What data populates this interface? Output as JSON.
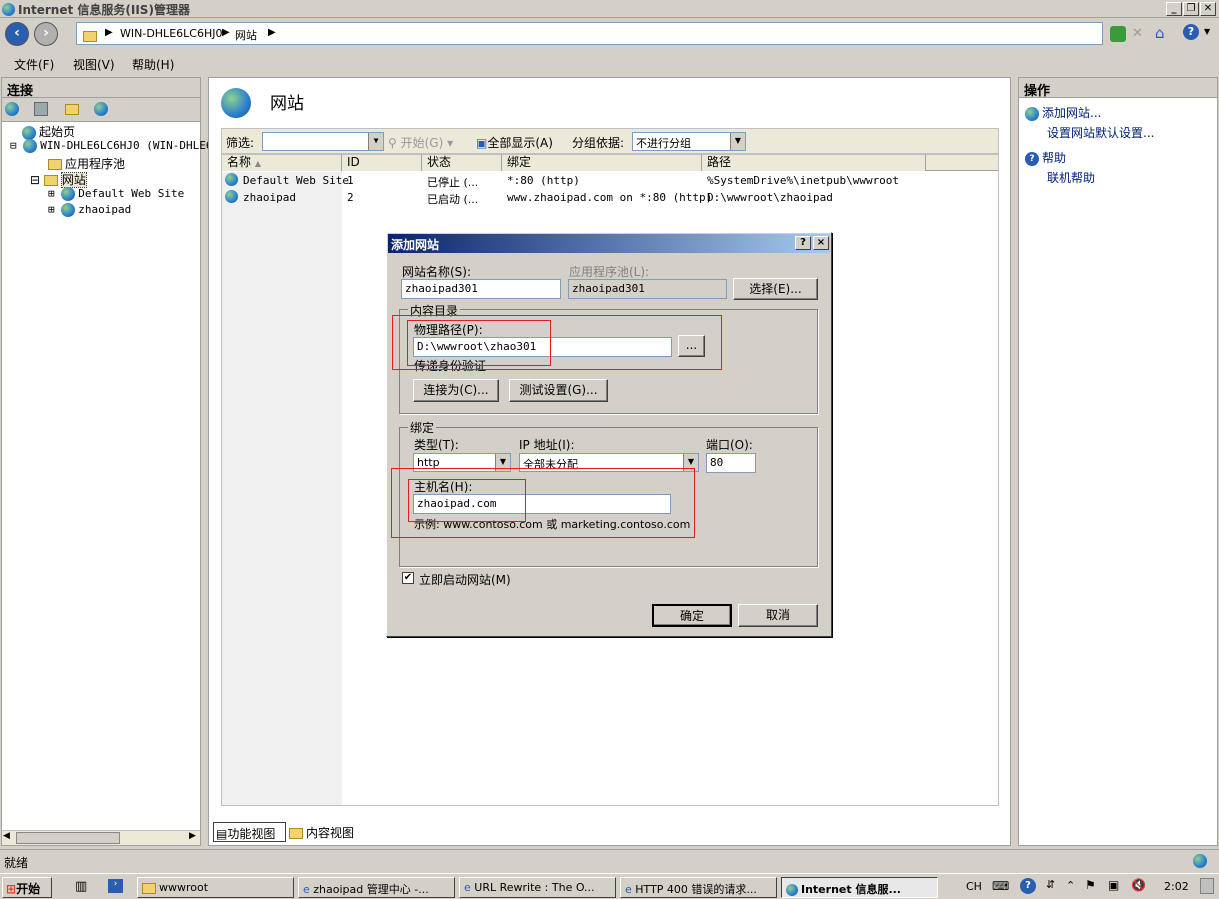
{
  "window": {
    "title": "Internet 信息服务(IIS)管理器"
  },
  "address": {
    "crumbs": [
      "WIN-DHLE6LC6HJ0",
      "网站"
    ]
  },
  "menu": [
    "文件(F)",
    "视图(V)",
    "帮助(H)"
  ],
  "connections": {
    "title": "连接",
    "tree": [
      "起始页",
      "WIN-DHLE6LC6HJ0 (WIN-DHLE6",
      "应用程序池",
      "网站",
      "Default Web Site",
      "zhaoipad"
    ]
  },
  "center": {
    "title": "网站",
    "filter_label": "筛选:",
    "start_label": "开始(G)",
    "showall_label": "全部显示(A)",
    "groupby_label": "分组依据:",
    "groupby_value": "不进行分组",
    "columns": [
      "名称",
      "ID",
      "状态",
      "绑定",
      "路径"
    ],
    "rows": [
      {
        "name": "Default Web Site",
        "id": "1",
        "status": "已停止 (...",
        "binding": "*:80 (http)",
        "path": "%SystemDrive%\\inetpub\\wwwroot"
      },
      {
        "name": "zhaoipad",
        "id": "2",
        "status": "已启动 (...",
        "binding": "www.zhaoipad.com on *:80 (http)",
        "path": "D:\\wwwroot\\zhaoipad"
      }
    ],
    "view_tabs": [
      "功能视图",
      "内容视图"
    ]
  },
  "actions": {
    "title": "操作",
    "items": [
      "添加网站...",
      "设置网站默认设置...",
      "帮助",
      "联机帮助"
    ]
  },
  "dialog": {
    "title": "添加网站",
    "help_btn": "?",
    "close_btn": "×",
    "site_name_label": "网站名称(S):",
    "site_name_value": "zhaoipad301",
    "app_pool_label": "应用程序池(L):",
    "app_pool_value": "zhaoipad301",
    "select_btn": "选择(E)...",
    "content_group": "内容目录",
    "physical_path_label": "物理路径(P):",
    "physical_path_value": "D:\\wwwroot\\zhao301",
    "browse_btn": "...",
    "passthrough_label": "传递身份验证",
    "connect_as_btn": "连接为(C)...",
    "test_settings_btn": "测试设置(G)...",
    "binding_group": "绑定",
    "type_label": "类型(T):",
    "type_value": "http",
    "ip_label": "IP 地址(I):",
    "ip_value": "全部未分配",
    "port_label": "端口(O):",
    "port_value": "80",
    "host_label": "主机名(H):",
    "host_value": "zhaoipad.com",
    "example_text": "示例: www.contoso.com 或 marketing.contoso.com",
    "start_now_label": "立即启动网站(M)",
    "start_now_checked": true,
    "ok_btn": "确定",
    "cancel_btn": "取消"
  },
  "status": {
    "text": "就绪"
  },
  "taskbar": {
    "start": "开始",
    "tasks": [
      "wwwroot",
      "zhaoipad 管理中心 -...",
      "URL Rewrite : The O...",
      "HTTP 400 错误的请求...",
      "Internet 信息服..."
    ],
    "lang": "CH",
    "clock": "2:02"
  }
}
